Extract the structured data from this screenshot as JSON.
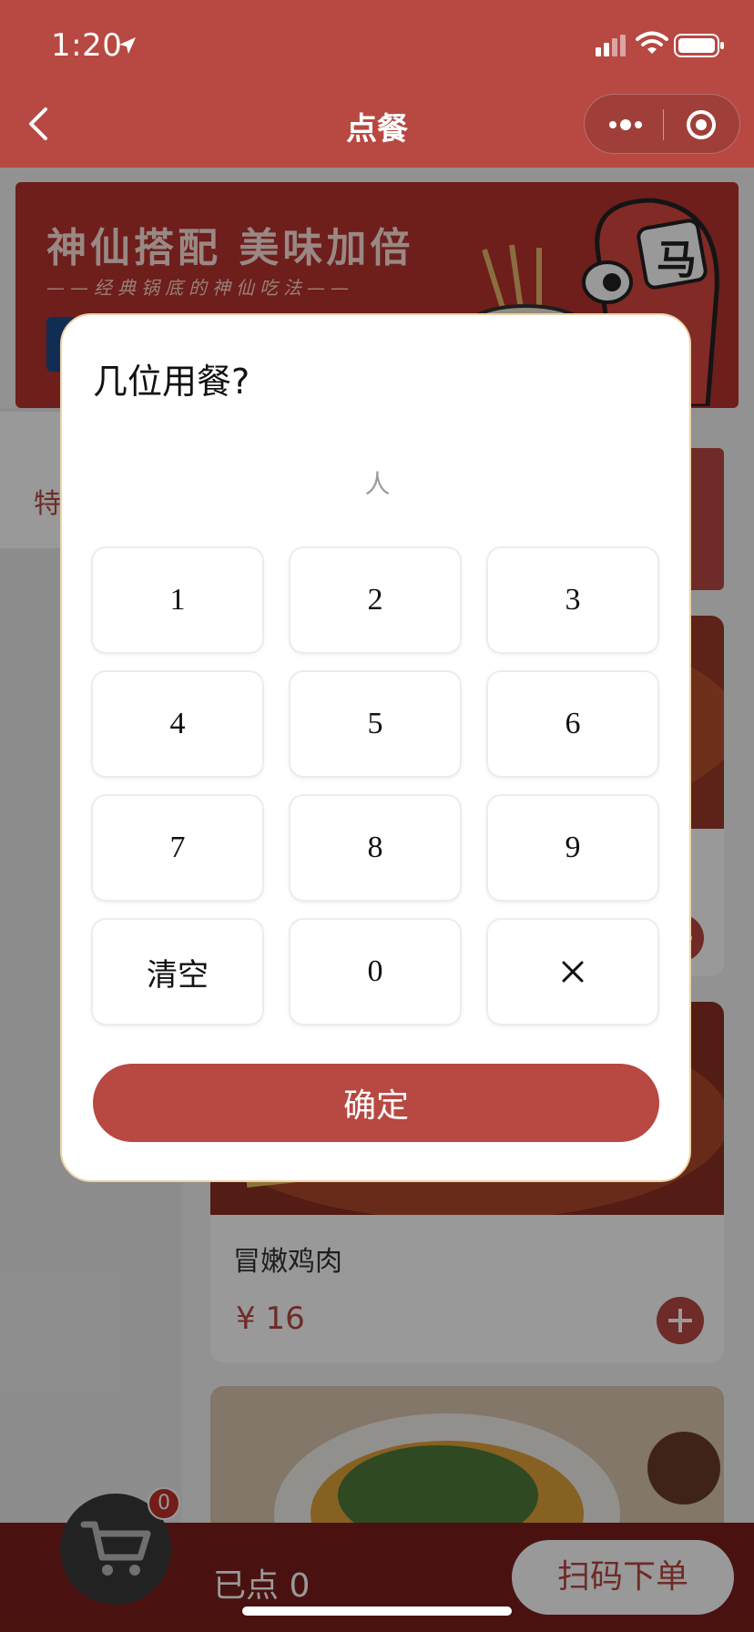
{
  "status_bar": {
    "time": "1:20"
  },
  "nav": {
    "title": "点餐"
  },
  "banner": {
    "title": "神仙搭配 美味加倍",
    "subtitle": "——经典锅底的神仙吃法——",
    "mascot_text": "马"
  },
  "sidebar": {
    "active_category_partial": "特"
  },
  "menu_items": [
    {
      "name": "冒嫩鸡肉",
      "price": "¥ 16"
    }
  ],
  "cart": {
    "badge_count": "0",
    "ordered_label": "已点 0",
    "scan_order_label": "扫码下单"
  },
  "modal": {
    "title": "几位用餐?",
    "count_value": "",
    "unit": "人",
    "keypad": {
      "row1": [
        "1",
        "2",
        "3"
      ],
      "row2": [
        "4",
        "5",
        "6"
      ],
      "row3": [
        "7",
        "8",
        "9"
      ],
      "clear_label": "清空",
      "zero": "0",
      "delete_icon": "close-x-icon"
    },
    "confirm_label": "确定"
  },
  "colors": {
    "brand_red": "#b74842",
    "price_red": "#b84841",
    "modal_border": "#eed3a6"
  }
}
